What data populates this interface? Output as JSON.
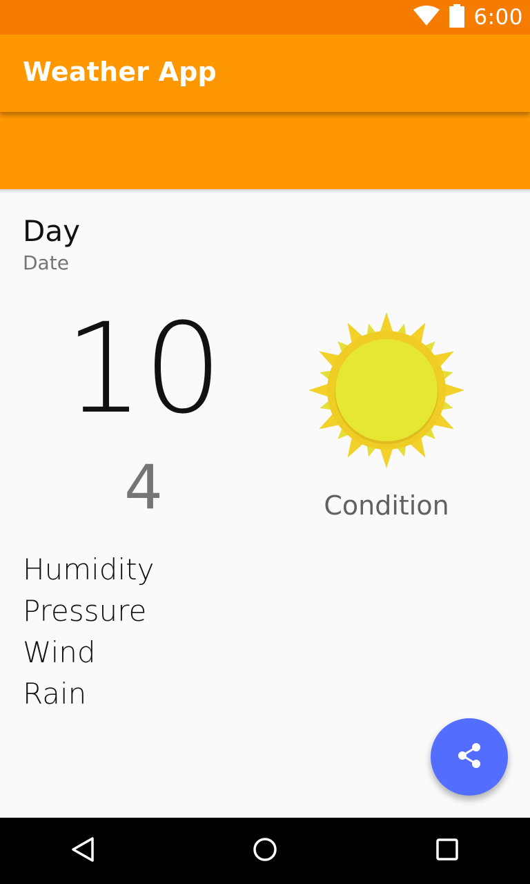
{
  "status_bar": {
    "time": "6:00",
    "icons": [
      "wifi-icon",
      "battery-icon"
    ]
  },
  "app_bar": {
    "title": "Weather App"
  },
  "forecast": {
    "day": "Day",
    "date": "Date",
    "high": "10",
    "low": "4",
    "condition": "Condition",
    "icon": "sun-icon"
  },
  "details": {
    "humidity": "Humidity",
    "pressure": "Pressure",
    "wind": "Wind",
    "rain": "Rain"
  },
  "fab": {
    "icon": "share-icon"
  },
  "nav_bar": {
    "icons": [
      "back-icon",
      "home-icon",
      "recents-icon"
    ]
  },
  "colors": {
    "status_bar": "#f57c00",
    "app_bar": "#ff9800",
    "fab": "#536dfe",
    "background": "#fafafa"
  }
}
